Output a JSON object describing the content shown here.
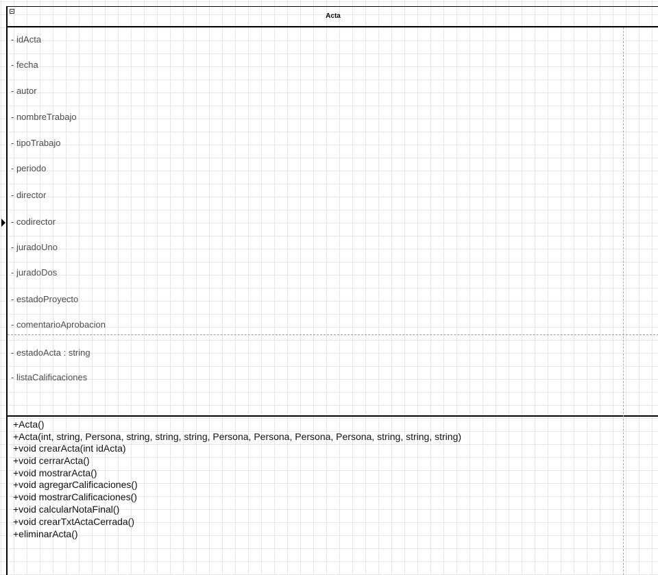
{
  "diagram": {
    "class_name": "Acta",
    "collapse_icon": "minus-box-icon",
    "attributes": [
      "- idActa",
      "- fecha",
      "- autor",
      "- nombreTrabajo",
      "- tipoTrabajo",
      "- periodo",
      "- director",
      "- codirector",
      "- juradoUno",
      "- juradoDos",
      "- estadoProyecto",
      "- comentarioAprobacion",
      "- estadoActa : string",
      "- listaCalificaciones"
    ],
    "methods": [
      "+Acta()",
      "+Acta(int, string, Persona, string, string, string, Persona, Persona, Persona, Persona, string, string, string)",
      "+void crearActa(int idActa)",
      "+void cerrarActa()",
      "+void mostrarActa()",
      "+void agregarCalificaciones()",
      "+void mostrarCalificaciones()",
      "+void calcularNotaFinal()",
      "+void crearTxtActaCerrada()",
      "+eliminarActa()"
    ]
  }
}
